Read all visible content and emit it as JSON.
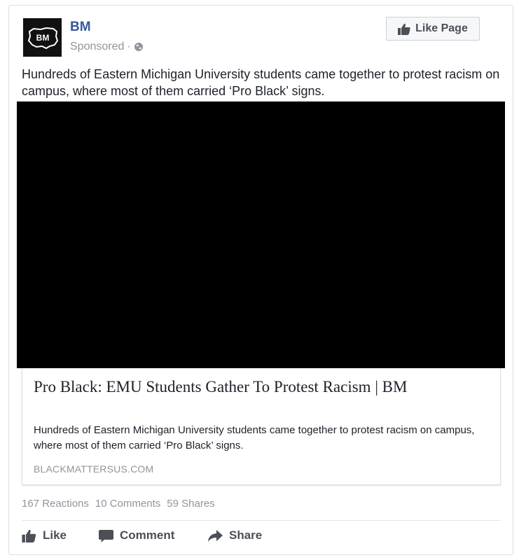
{
  "post": {
    "page_name": "BM",
    "avatar_text": "BM",
    "sponsored_label": "Sponsored",
    "separator": "·",
    "privacy_icon": "globe-icon",
    "like_page_label": "Like Page",
    "text": "Hundreds of Eastern Michigan University students came together to protest racism on campus, where most of them carried ‘Pro Black’ signs."
  },
  "link": {
    "title": "Pro Black: EMU Students Gather To Protest Racism | BM",
    "description": "Hundreds of Eastern Michigan University students came together to protest racism on campus, where most of them carried ‘Pro Black’ signs.",
    "domain": "BLACKMATTERSUS.COM"
  },
  "stats": {
    "reactions": "167 Reactions",
    "comments": "10 Comments",
    "shares": "59 Shares"
  },
  "actions": {
    "like": "Like",
    "comment": "Comment",
    "share": "Share"
  },
  "colors": {
    "page_name": "#365899",
    "muted": "#90949c",
    "action": "#4b4f56"
  }
}
